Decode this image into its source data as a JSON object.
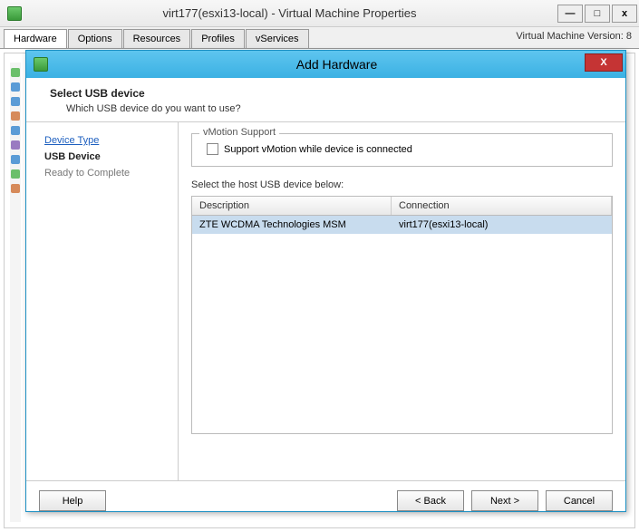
{
  "parent": {
    "title": "virt177(esxi13-local) - Virtual Machine Properties",
    "tabs": [
      "Hardware",
      "Options",
      "Resources",
      "Profiles",
      "vServices"
    ],
    "version_label": "Virtual Machine Version: 8",
    "controls": {
      "minimize": "—",
      "maximize": "□",
      "close": "x"
    }
  },
  "dialog": {
    "title": "Add Hardware",
    "close_glyph": "X",
    "heading": "Select USB device",
    "subheading": "Which USB device do you want to use?",
    "nav": {
      "step1": "Device Type",
      "step2": "USB Device",
      "step3": "Ready to Complete"
    },
    "vmotion": {
      "legend": "vMotion Support",
      "checkbox_label": "Support vMotion while device is connected",
      "checked": false
    },
    "select_label": "Select the host USB device below:",
    "table": {
      "headers": {
        "description": "Description",
        "connection": "Connection"
      },
      "rows": [
        {
          "description": "ZTE WCDMA Technologies MSM",
          "connection": "virt177(esxi13-local)",
          "selected": true
        }
      ]
    },
    "buttons": {
      "help": "Help",
      "back": "< Back",
      "next": "Next >",
      "cancel": "Cancel"
    }
  }
}
